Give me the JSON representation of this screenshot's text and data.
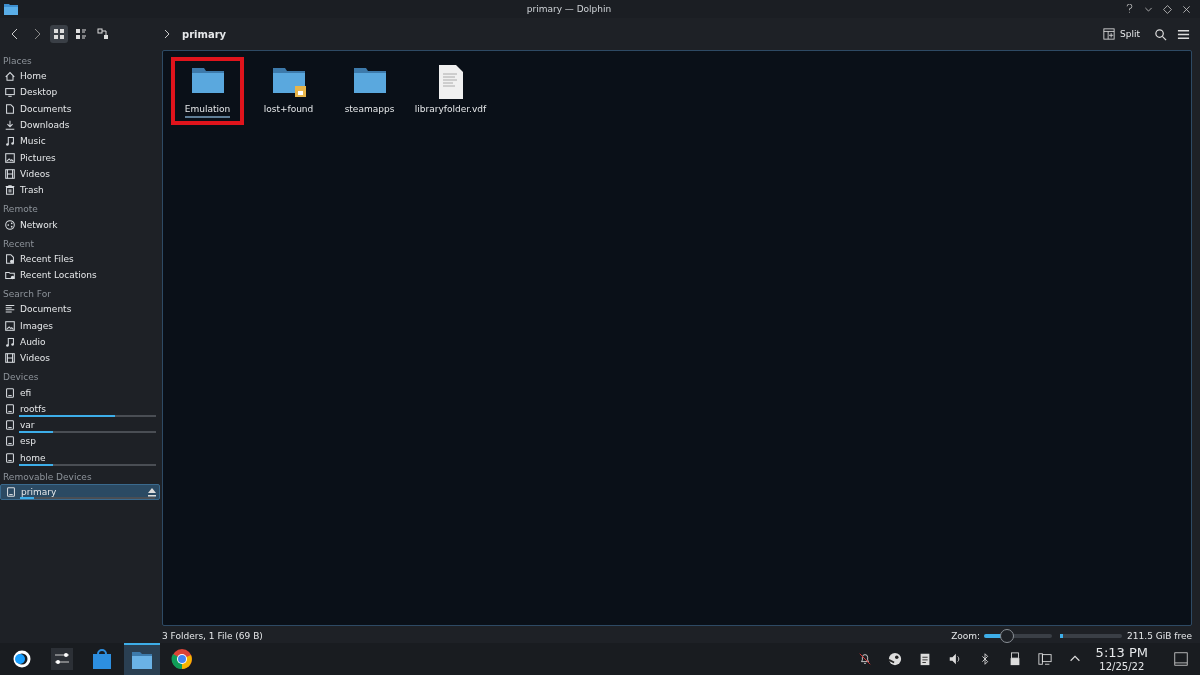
{
  "window": {
    "title": "primary — Dolphin"
  },
  "toolbar": {
    "breadcrumb": "primary",
    "split_label": "Split",
    "view_modes": [
      {
        "selected": true
      },
      {
        "selected": false
      },
      {
        "selected": false
      }
    ]
  },
  "sidebar": {
    "groups": [
      {
        "title": "Places",
        "items": [
          {
            "label": "Home",
            "selected": false
          },
          {
            "label": "Desktop",
            "selected": false
          },
          {
            "label": "Documents",
            "selected": false
          },
          {
            "label": "Downloads",
            "selected": false
          },
          {
            "label": "Music",
            "selected": false
          },
          {
            "label": "Pictures",
            "selected": false
          },
          {
            "label": "Videos",
            "selected": false
          },
          {
            "label": "Trash",
            "selected": false
          }
        ]
      },
      {
        "title": "Remote",
        "items": [
          {
            "label": "Network",
            "selected": false
          }
        ]
      },
      {
        "title": "Recent",
        "items": [
          {
            "label": "Recent Files",
            "selected": false
          },
          {
            "label": "Recent Locations",
            "selected": false
          }
        ]
      },
      {
        "title": "Search For",
        "items": [
          {
            "label": "Documents",
            "selected": false
          },
          {
            "label": "Images",
            "selected": false
          },
          {
            "label": "Audio",
            "selected": false
          },
          {
            "label": "Videos",
            "selected": false
          }
        ]
      },
      {
        "title": "Devices",
        "items": [
          {
            "label": "efi",
            "selected": false
          },
          {
            "label": "rootfs",
            "selected": false,
            "level": 0.7
          },
          {
            "label": "var",
            "selected": false,
            "level": 0.25
          },
          {
            "label": "esp",
            "selected": false
          },
          {
            "label": "home",
            "selected": false,
            "level": 0.25
          }
        ]
      },
      {
        "title": "Removable Devices",
        "items": [
          {
            "label": "primary",
            "selected": true,
            "level": 0.1,
            "ejectable": true
          }
        ]
      }
    ]
  },
  "files": [
    {
      "name": "Emulation",
      "kind": "folder",
      "focused": true,
      "highlighted": true
    },
    {
      "name": "lost+found",
      "kind": "locked-folder",
      "focused": false,
      "highlighted": false
    },
    {
      "name": "steamapps",
      "kind": "folder",
      "focused": false,
      "highlighted": false
    },
    {
      "name": "libraryfolder.vdf",
      "kind": "file",
      "focused": false,
      "highlighted": false
    }
  ],
  "status_bar": {
    "summary": "3 Folders, 1 File (69 B)",
    "zoom_label": "Zoom:",
    "zoom": {
      "level": 0.3
    },
    "space": {
      "level": 0.05
    },
    "free": "211.5 GiB free"
  },
  "taskbar": {
    "apps": [
      {
        "active": false
      },
      {
        "active": false
      },
      {
        "active": false
      },
      {
        "active": true
      },
      {
        "active": false
      }
    ],
    "time": "5:13 PM",
    "date": "12/25/22"
  }
}
